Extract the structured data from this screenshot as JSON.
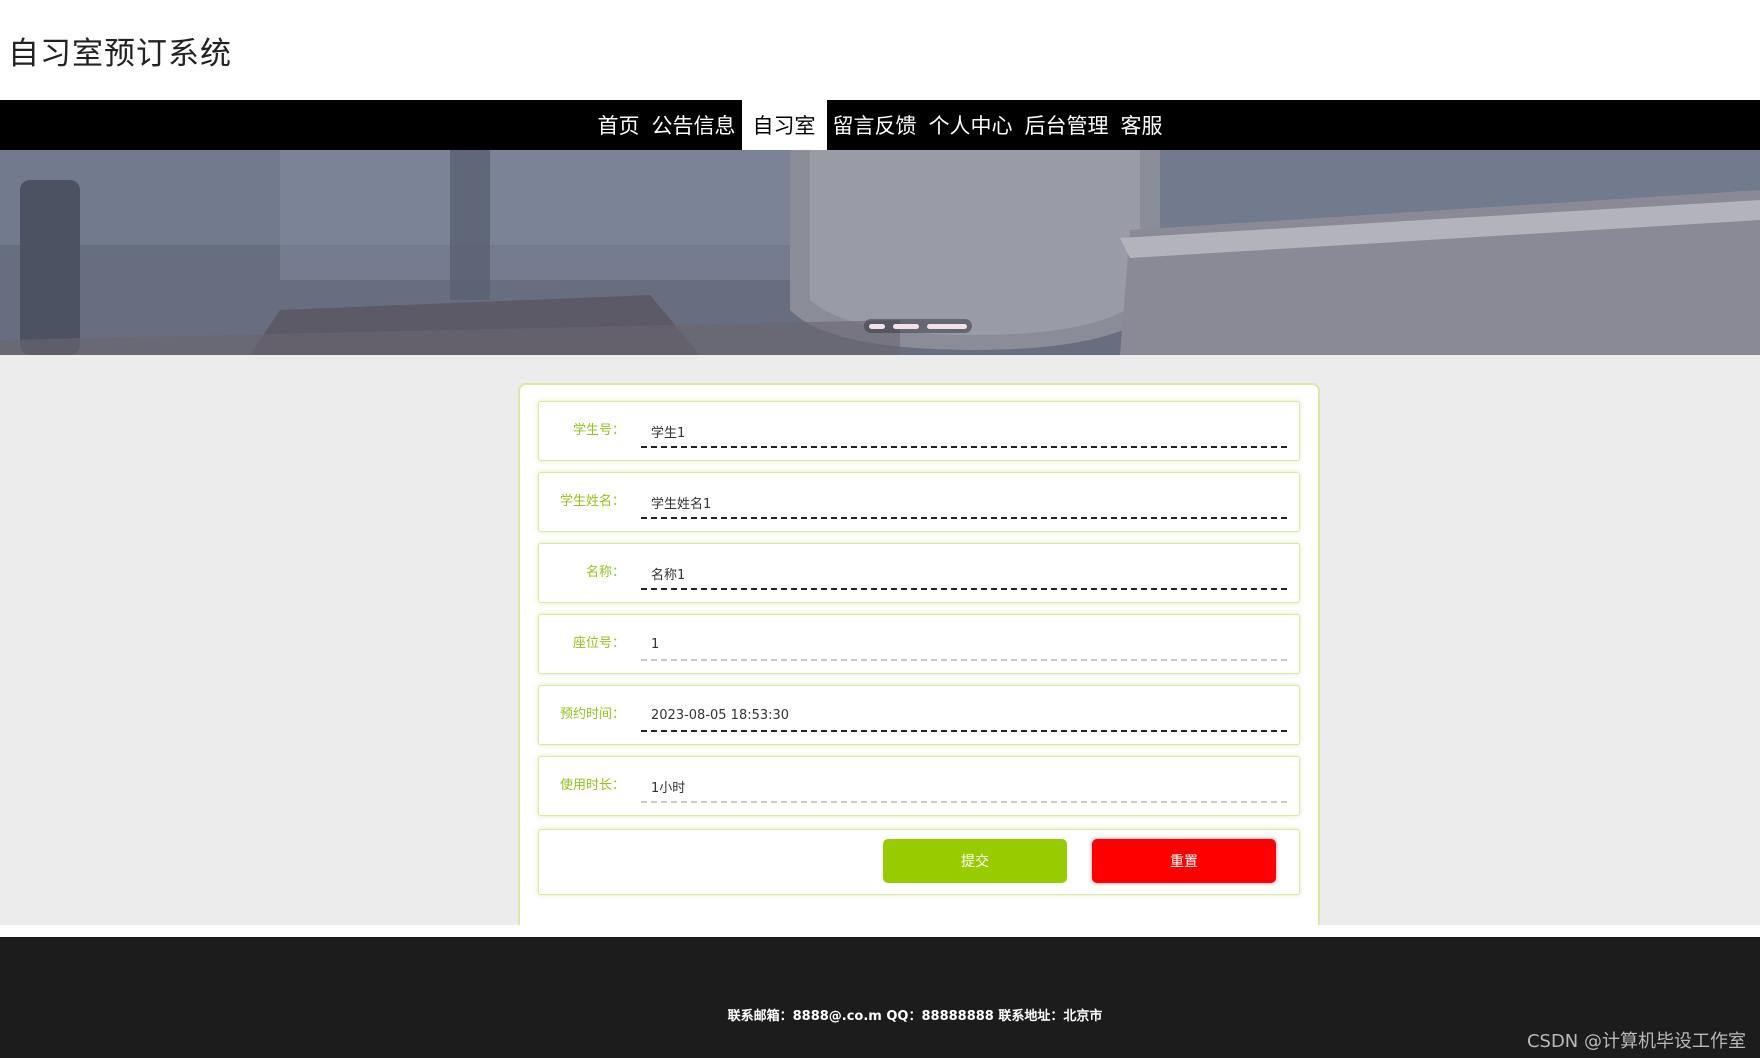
{
  "site": {
    "title": "自习室预订系统"
  },
  "nav": {
    "items": [
      {
        "label": "首页",
        "active": false
      },
      {
        "label": "公告信息",
        "active": false
      },
      {
        "label": "自习室",
        "active": true
      },
      {
        "label": "留言反馈",
        "active": false
      },
      {
        "label": "个人中心",
        "active": false
      },
      {
        "label": "后台管理",
        "active": false
      },
      {
        "label": "客服",
        "active": false
      }
    ]
  },
  "banner": {
    "slides": 3,
    "active_slide": 3
  },
  "form": {
    "fields": [
      {
        "label": "学生号：",
        "value": "学生1"
      },
      {
        "label": "学生姓名：",
        "value": "学生姓名1"
      },
      {
        "label": "名称：",
        "value": "名称1"
      },
      {
        "label": "座位号：",
        "value": "1"
      },
      {
        "label": "预约时间：",
        "value": "2023-08-05 18:53:30"
      },
      {
        "label": "使用时长：",
        "value": "1小时"
      }
    ],
    "submit_label": "提交",
    "reset_label": "重置"
  },
  "footer": {
    "text": "联系邮箱：8888@.co.m QQ：88888888 联系地址：北京市",
    "watermark": "CSDN @计算机毕设工作室"
  },
  "colors": {
    "accent_green": "#99cc00",
    "label_green": "#8fc31f",
    "reset_red": "#ff0000",
    "nav_bg": "#000000",
    "footer_bg": "#1c1c1c"
  }
}
